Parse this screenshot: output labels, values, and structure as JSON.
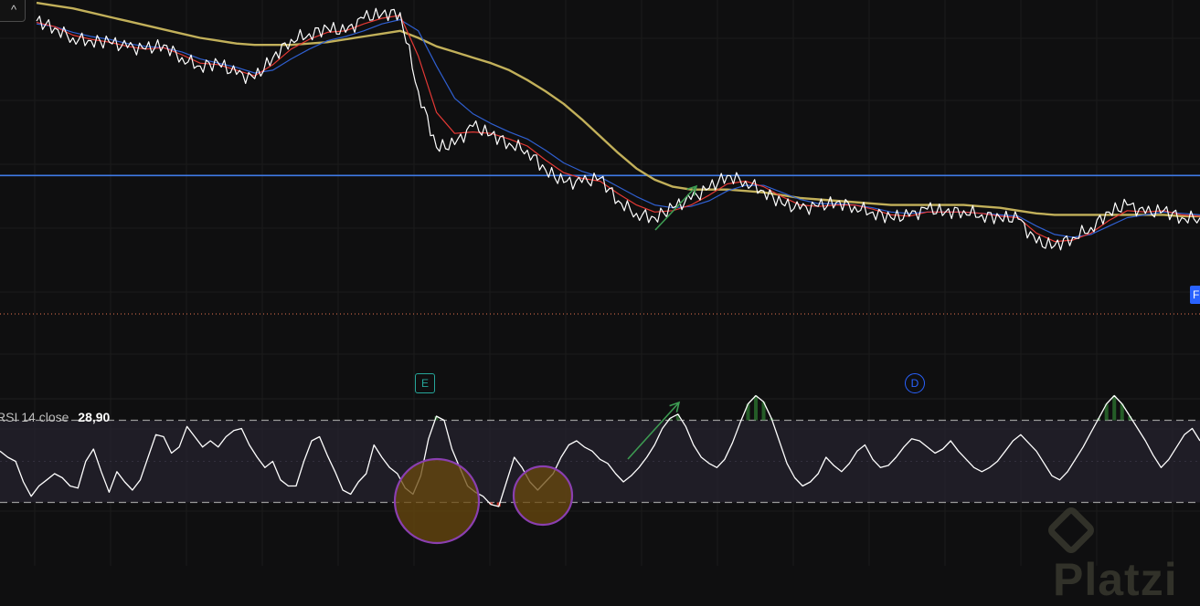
{
  "colors": {
    "background": "#0f0f10",
    "price": "#ffffff",
    "ema_fast": "#e53935",
    "ema_mid": "#2f5fd0",
    "sma_slow": "#c2b05a",
    "horizontal_level": "#3f7be8",
    "rsi_line": "#ffffff",
    "rsi_band": "#2a2636",
    "annotation_arrow": "#3d9b52",
    "circle_fill": "#6b4a0e",
    "circle_stroke": "#8a3fb0",
    "oversold_fill": "#e0392f",
    "overbought_fill": "#2e7d32",
    "badge_e": "#26a69a",
    "badge_d": "#2962ff"
  },
  "toolbar": {
    "collapse_icon": "chevron-up-icon",
    "collapse_glyph": "^"
  },
  "rsi": {
    "name": "RSI",
    "length": "14",
    "source": "close",
    "value": "28,90"
  },
  "events": {
    "earnings_label": "E",
    "dividend_label": "D"
  },
  "price_tag": {
    "text": "F"
  },
  "watermark": {
    "text": "Platzi",
    "icon": "platzi-logo-icon"
  },
  "chart_data": [
    {
      "type": "line",
      "panel": "price",
      "grid": true,
      "series": [
        {
          "key": "price",
          "values": [
            100,
            99.5,
            98.8,
            98.6,
            98.5,
            98.1,
            98.0,
            98.3,
            97.4,
            96.8,
            97.0,
            96.2,
            95.9,
            97.4,
            98.7,
            99.1,
            99.5,
            99.2,
            100.2,
            100.5,
            100.6,
            95.0,
            91.0,
            91.2,
            92.5,
            91.9,
            91.3,
            90.8,
            89.4,
            88.5,
            88.5,
            88.8,
            87.2,
            86.3,
            86.0,
            86.7,
            87.3,
            88.1,
            89.0,
            88.6,
            87.9,
            87.0,
            86.6,
            86.8,
            87.1,
            86.8,
            86.4,
            86.0,
            86.1,
            86.6,
            86.4,
            86.5,
            86.2,
            86.0,
            85.9,
            84.2,
            84.0,
            84.6,
            85.3,
            86.4,
            86.9,
            86.3,
            86.5,
            86.0,
            86.0
          ]
        },
        {
          "key": "ema_fast",
          "values": [
            99.9,
            99.6,
            99.0,
            98.7,
            98.5,
            98.2,
            98.0,
            98.1,
            97.6,
            97.0,
            96.9,
            96.5,
            96.1,
            96.9,
            98.0,
            98.7,
            99.2,
            99.3,
            99.8,
            100.2,
            100.4,
            97.5,
            93.5,
            92.0,
            92.1,
            92.0,
            91.6,
            91.1,
            90.1,
            89.2,
            88.8,
            88.6,
            87.7,
            86.9,
            86.4,
            86.5,
            86.9,
            87.6,
            88.4,
            88.6,
            88.2,
            87.5,
            86.9,
            86.8,
            86.9,
            86.9,
            86.6,
            86.2,
            86.1,
            86.4,
            86.4,
            86.4,
            86.3,
            86.1,
            86.0,
            84.9,
            84.3,
            84.4,
            84.9,
            85.8,
            86.5,
            86.4,
            86.5,
            86.2,
            86.1
          ]
        },
        {
          "key": "ema_mid",
          "values": [
            99.8,
            99.6,
            99.2,
            98.9,
            98.7,
            98.4,
            98.2,
            98.1,
            97.8,
            97.3,
            97.0,
            96.7,
            96.3,
            96.5,
            97.3,
            98.0,
            98.6,
            98.9,
            99.3,
            99.8,
            100.1,
            99.3,
            96.8,
            94.5,
            93.4,
            92.7,
            92.1,
            91.6,
            90.8,
            89.9,
            89.3,
            88.9,
            88.2,
            87.5,
            86.9,
            86.7,
            86.8,
            87.2,
            87.9,
            88.3,
            88.3,
            87.8,
            87.3,
            87.0,
            87.0,
            86.9,
            86.7,
            86.4,
            86.3,
            86.4,
            86.4,
            86.4,
            86.3,
            86.2,
            86.1,
            85.4,
            84.8,
            84.6,
            84.8,
            85.4,
            86.0,
            86.2,
            86.4,
            86.3,
            86.2
          ]
        },
        {
          "key": "sma_slow",
          "values": [
            101.3,
            101.1,
            100.9,
            100.6,
            100.3,
            100.0,
            99.7,
            99.4,
            99.1,
            98.8,
            98.6,
            98.4,
            98.3,
            98.3,
            98.3,
            98.4,
            98.5,
            98.7,
            98.9,
            99.1,
            99.3,
            98.8,
            98.2,
            97.8,
            97.4,
            97.0,
            96.5,
            95.8,
            95.0,
            94.1,
            93.0,
            91.8,
            90.6,
            89.5,
            88.7,
            88.2,
            88.0,
            88.0,
            88.0,
            87.9,
            87.8,
            87.6,
            87.4,
            87.3,
            87.2,
            87.1,
            87.0,
            86.9,
            86.9,
            86.9,
            86.9,
            86.9,
            86.8,
            86.7,
            86.5,
            86.3,
            86.2,
            86.2,
            86.2,
            86.2,
            86.2,
            86.2,
            86.2,
            86.1,
            86.1
          ]
        }
      ],
      "ylim": [
        82.0,
        101.5
      ],
      "horizontal_level": 89.0
    },
    {
      "type": "line",
      "panel": "rsi",
      "grid": true,
      "series": [
        {
          "key": "rsi",
          "values": [
            55,
            52,
            50,
            40,
            33,
            38,
            41,
            44,
            42,
            38,
            37,
            50,
            56,
            45,
            35,
            45,
            40,
            36,
            41,
            52,
            63,
            62,
            54,
            57,
            67,
            62,
            57,
            60,
            57,
            62,
            65,
            66,
            58,
            52,
            47,
            50,
            41,
            38,
            38,
            50,
            60,
            62,
            53,
            45,
            36,
            34,
            40,
            44,
            58,
            52,
            47,
            44,
            37,
            34,
            43,
            61,
            72,
            70,
            56,
            47,
            38,
            35,
            33,
            29,
            28,
            40,
            52,
            47,
            40,
            36,
            40,
            44,
            52,
            58,
            60,
            57,
            55,
            51,
            49,
            44,
            40,
            43,
            47,
            52,
            58,
            66,
            71,
            73,
            67,
            58,
            52,
            49,
            47,
            51,
            59,
            69,
            78,
            82,
            79,
            71,
            60,
            49,
            42,
            38,
            40,
            44,
            52,
            48,
            45,
            49,
            55,
            58,
            51,
            47,
            48,
            52,
            57,
            61,
            60,
            57,
            54,
            56,
            60,
            55,
            51,
            47,
            45,
            47,
            50,
            55,
            60,
            63,
            59,
            55,
            49,
            43,
            41,
            45,
            51,
            57,
            64,
            71,
            78,
            82,
            78,
            72,
            66,
            60,
            53,
            47,
            51,
            57,
            63,
            66,
            60
          ],
          "note": ""
        }
      ],
      "ylim": [
        0,
        100
      ],
      "bands": [
        70,
        30
      ]
    }
  ]
}
